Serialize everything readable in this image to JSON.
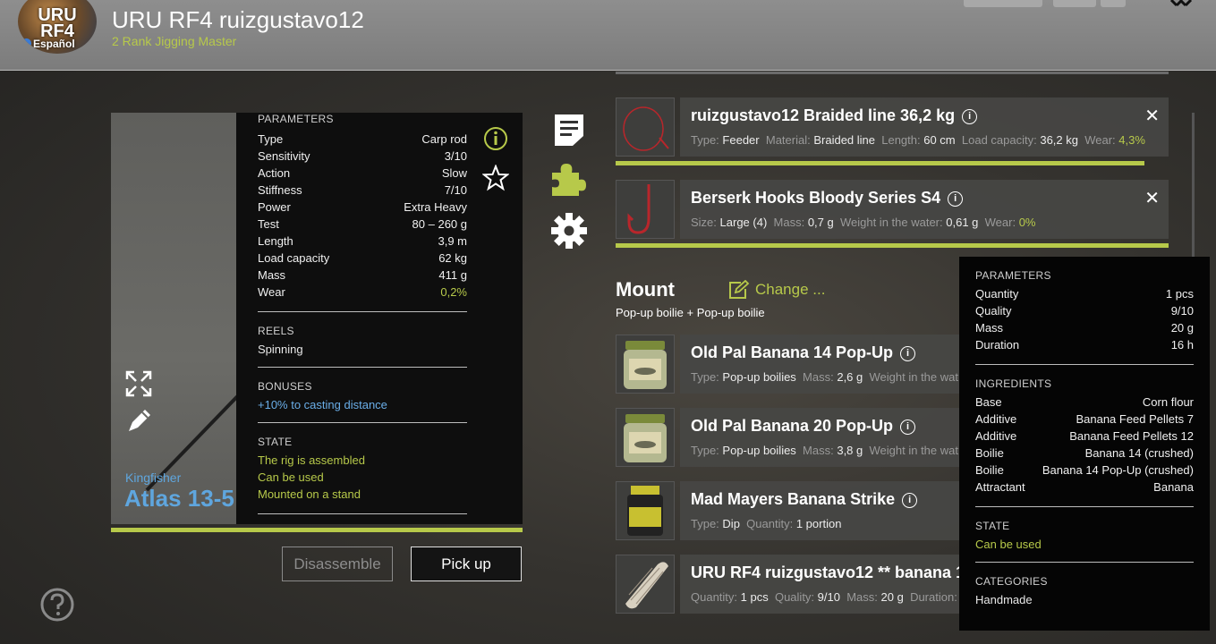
{
  "header": {
    "avatar_text": "URU RF4",
    "avatar_lang": "Español",
    "username": "URU RF4 ruizgustavo12",
    "rank": "2 Rank Jigging Master"
  },
  "rod": {
    "brand": "Kingfisher",
    "model": "Atlas 13-5",
    "parameters_title": "PARAMETERS",
    "parameters": [
      {
        "label": "Type",
        "value": "Carp rod"
      },
      {
        "label": "Sensitivity",
        "value": "3/10"
      },
      {
        "label": "Action",
        "value": "Slow"
      },
      {
        "label": "Stiffness",
        "value": "7/10"
      },
      {
        "label": "Power",
        "value": "Extra Heavy"
      },
      {
        "label": "Test",
        "value": "80 – 260 g"
      },
      {
        "label": "Length",
        "value": "3,9 m"
      },
      {
        "label": "Load capacity",
        "value": "62 kg"
      },
      {
        "label": "Mass",
        "value": "411 g"
      },
      {
        "label": "Wear",
        "value": "0,2%"
      }
    ],
    "reels_title": "REELS",
    "reels_value": "Spinning",
    "bonuses_title": "BONUSES",
    "bonus_value": "+10% to casting distance",
    "state_title": "STATE",
    "states": [
      "The rig is assembled",
      "Can be used",
      "Mounted on a stand"
    ],
    "disassemble_label": "Disassemble",
    "pickup_label": "Pick up"
  },
  "line_item": {
    "title": "ruizgustavo12 Braided line 36,2 kg",
    "type_label": "Type:",
    "type_value": "Feeder",
    "material_label": "Material:",
    "material_value": "Braided line",
    "length_label": "Length:",
    "length_value": "60 cm",
    "load_label": "Load capacity:",
    "load_value": "36,2 kg",
    "wear_label": "Wear:",
    "wear_value": "4,3%",
    "wear_fraction": 0.957
  },
  "hook_item": {
    "title": "Berserk Hooks Bloody Series S4",
    "size_label": "Size:",
    "size_value": "Large (4)",
    "mass_label": "Mass:",
    "mass_value": "0,7 g",
    "water_label": "Weight in the water:",
    "water_value": "0,61 g",
    "wear_label": "Wear:",
    "wear_value": "0%",
    "wear_fraction": 1.0
  },
  "mount": {
    "title": "Mount",
    "change_label": "Change ...",
    "subtitle": "Pop-up boilie + Pop-up boilie"
  },
  "baits": [
    {
      "title": "Old Pal Banana 14 Pop-Up",
      "l1": "Type:",
      "v1": "Pop-up boilies",
      "l2": "Mass:",
      "v2": "2,6 g",
      "l3": "Weight in the wat"
    },
    {
      "title": "Old Pal Banana 20 Pop-Up",
      "l1": "Type:",
      "v1": "Pop-up boilies",
      "l2": "Mass:",
      "v2": "3,8 g",
      "l3": "Weight in the wat"
    },
    {
      "title": "Mad Mayers Banana Strike",
      "l1": "Type:",
      "v1": "Dip",
      "l2": "Quantity:",
      "v2": "1 portion",
      "l3": ""
    },
    {
      "title": "URU RF4 ruizgustavo12 ** banana 1",
      "l1": "Quantity:",
      "v1": "1 pcs",
      "l2": "Quality:",
      "v2": "9/10",
      "l3": "Mass:",
      "v3": "20 g",
      "l4": "Duration:"
    }
  ],
  "tooltip": {
    "parameters_title": "PARAMETERS",
    "parameters": [
      {
        "label": "Quantity",
        "value": "1 pcs"
      },
      {
        "label": "Quality",
        "value": "9/10"
      },
      {
        "label": "Mass",
        "value": "20 g"
      },
      {
        "label": "Duration",
        "value": "16 h"
      }
    ],
    "ingredients_title": "INGREDIENTS",
    "ingredients": [
      {
        "label": "Base",
        "value": "Corn flour"
      },
      {
        "label": "Additive",
        "value": "Banana Feed Pellets 7"
      },
      {
        "label": "Additive",
        "value": "Banana Feed Pellets 12"
      },
      {
        "label": "Boilie",
        "value": "Banana 14 (crushed)"
      },
      {
        "label": "Boilie",
        "value": "Banana 14 Pop-Up (crushed)"
      },
      {
        "label": "Attractant",
        "value": "Banana"
      }
    ],
    "state_title": "STATE",
    "state_value": "Can be used",
    "categories_title": "CATEGORIES",
    "categories_value": "Handmade"
  },
  "colors": {
    "accent": "#b7c94a",
    "link": "#6aaee8"
  },
  "icons": {
    "info": "info-icon",
    "star": "star-icon",
    "expand": "expand-icon",
    "pencil": "pencil-icon",
    "document": "document-icon",
    "puzzle": "puzzle-icon",
    "gear": "gear-icon",
    "help": "help-icon",
    "close": "close-icon",
    "edit": "edit-icon"
  }
}
